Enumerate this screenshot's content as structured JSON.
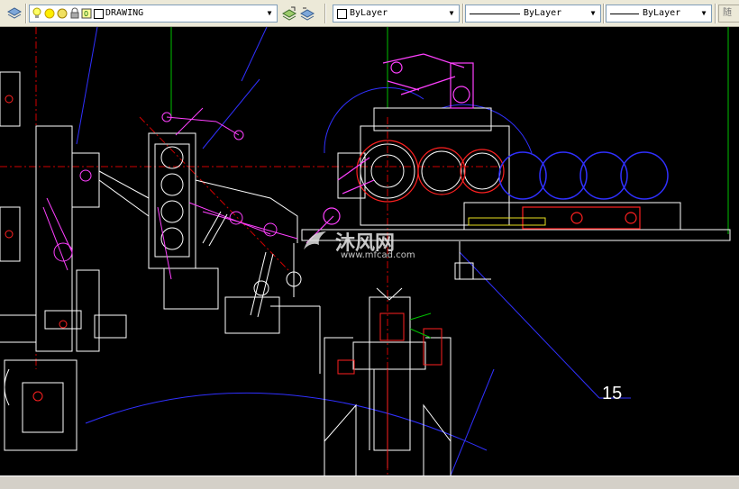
{
  "toolbar": {
    "layer_name": "DRAWING",
    "color_value": "ByLayer",
    "linetype_value": "ByLayer",
    "lineweight_value": "ByLayer",
    "overflow_label": "随"
  },
  "drawing": {
    "annotation": "15",
    "watermark_name": "沐风网",
    "watermark_url": "www.mfcad.com"
  },
  "colors": {
    "background": "#000000",
    "magenta": "#ff00ff",
    "red": "#ff0000",
    "blue": "#0000ff",
    "green": "#00ff00",
    "white": "#ffffff",
    "yellow": "#ffff00"
  }
}
